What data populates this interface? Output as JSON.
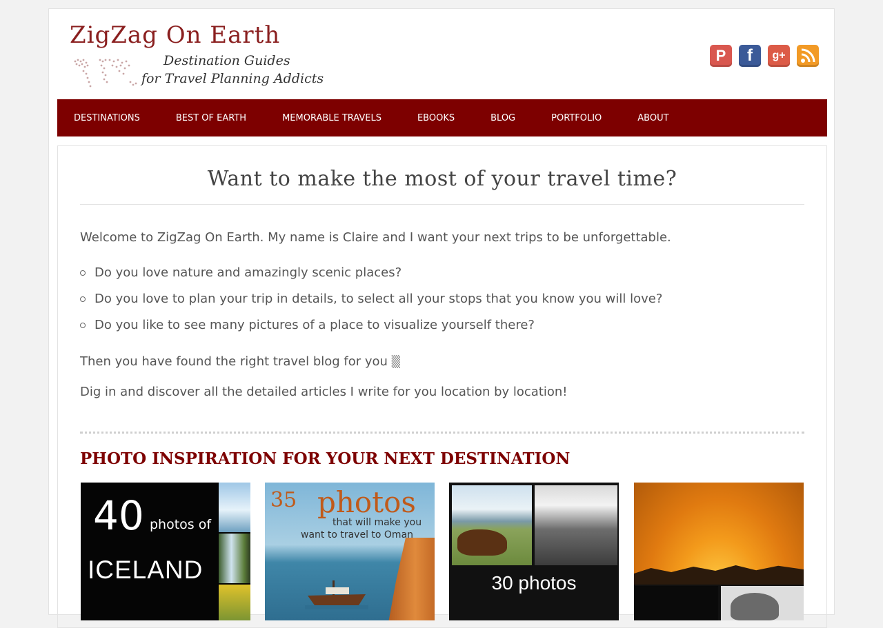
{
  "site": {
    "title": "ZigZag On Earth",
    "tagline_line1": "Destination Guides",
    "tagline_line2": "for Travel Planning Addicts"
  },
  "social": [
    {
      "name": "pinterest",
      "icon": "pinterest-icon",
      "glyph": "P",
      "color": "#d9574f"
    },
    {
      "name": "facebook",
      "icon": "facebook-icon",
      "glyph": "f",
      "color": "#3b5a98"
    },
    {
      "name": "googleplus",
      "icon": "google-plus-icon",
      "glyph": "g+",
      "color": "#dc5b47"
    },
    {
      "name": "rss",
      "icon": "rss-icon",
      "glyph": "",
      "color": "#f29a26"
    }
  ],
  "nav": {
    "items": [
      "DESTINATIONS",
      "BEST OF EARTH",
      "MEMORABLE TRAVELS",
      "EBOOKS",
      "BLOG",
      "PORTFOLIO",
      "ABOUT"
    ],
    "color": "#7d0000"
  },
  "main": {
    "title": "Want to make the most of your travel time?",
    "intro": "Welcome to ZigZag On Earth. My name is Claire and I want your next trips to be unforgettable.",
    "bullets": [
      "Do you love nature and amazingly scenic places?",
      "Do you love to plan your trip in details, to select all your stops that you know you will love?",
      "Do you like to see many pictures of a place to visualize yourself there?"
    ],
    "closing1": "Then you have found the right travel blog for you",
    "closing1_glyph": "▒",
    "closing2": "Dig in and discover all the detailed articles I write for you location by location!",
    "section_title": "PHOTO INSPIRATION FOR YOUR NEXT DESTINATION"
  },
  "thumbs": {
    "iceland": {
      "number": "40",
      "small": "photos of",
      "big": "ICELAND"
    },
    "oman": {
      "number": "35",
      "word": "photos",
      "sub1": "that will make you",
      "sub2": "want to travel to Oman"
    },
    "horse": {
      "caption": "30 photos",
      "caption2": "... "
    },
    "sunset": {}
  }
}
